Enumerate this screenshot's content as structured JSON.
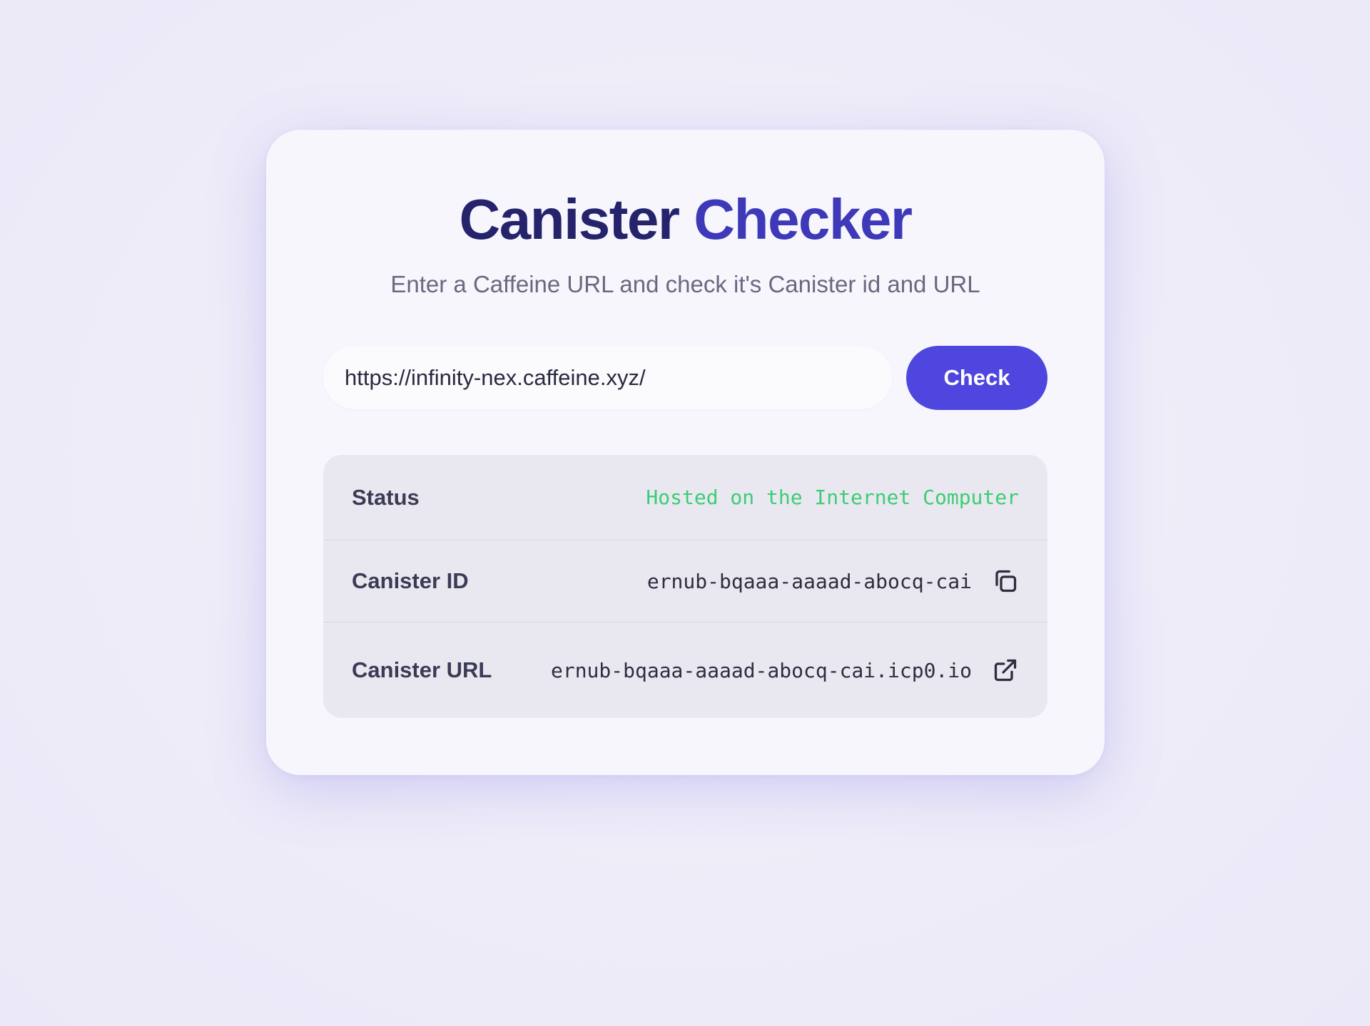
{
  "app": {
    "title_part1": "Canister",
    "title_part2": "Checker",
    "subtitle": "Enter a Caffeine URL and check it's Canister id and URL"
  },
  "search": {
    "value": "https://infinity-nex.caffeine.xyz/",
    "button_label": "Check"
  },
  "results": {
    "status": {
      "label": "Status",
      "value": "Hosted on the Internet Computer"
    },
    "canister_id": {
      "label": "Canister ID",
      "value": "ernub-bqaaa-aaaad-abocq-cai",
      "icon": "copy-icon"
    },
    "canister_url": {
      "label": "Canister URL",
      "value": "ernub-bqaaa-aaaad-abocq-cai.icp0.io",
      "icon": "external-link-icon"
    }
  },
  "colors": {
    "title_dark": "#25236b",
    "title_accent": "#3e39b8",
    "button": "#4e46de",
    "status_ok": "#3ccd73"
  }
}
